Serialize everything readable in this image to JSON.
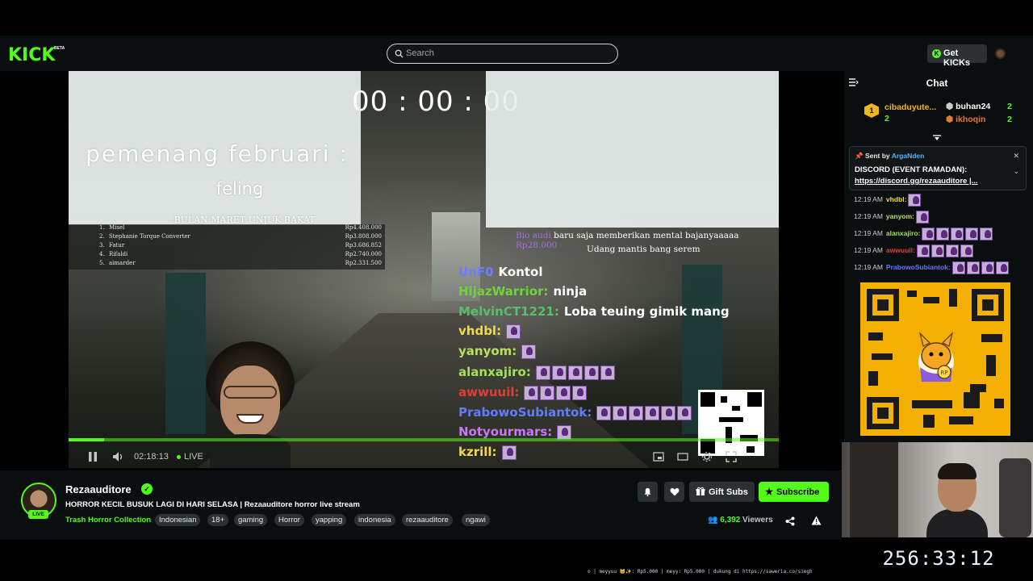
{
  "header": {
    "logo": "KICK",
    "logo_badge": "BETA",
    "search_placeholder": "Search",
    "get_kicks_label": "Get KICKs"
  },
  "overlay": {
    "countdown": "00 : 00 : 00",
    "winner_title": "pemenang februari :",
    "winner_name": "feling",
    "winner_sub": "BULAN MARET UNJUK BAKAT",
    "leaderboard": [
      {
        "rank": "1.",
        "name": "Misel",
        "amount": "Rp4.408.000"
      },
      {
        "rank": "2.",
        "name": "Stephanie Torque Converter",
        "amount": "Rp3.808.000"
      },
      {
        "rank": "3.",
        "name": "Fatur",
        "amount": "Rp3.686.852"
      },
      {
        "rank": "4.",
        "name": "Rifaldi",
        "amount": "Rp2.740.000"
      },
      {
        "rank": "5.",
        "name": "aimarder",
        "amount": "Rp2.331.500"
      }
    ],
    "donation": {
      "name": "Bio audi",
      "text": " baru saja memberikan mental bajanyaaaaa ",
      "amount": "Rp28.000",
      "message": "Udang mantis bang serem"
    },
    "chat_lines": [
      {
        "user": "UnF0",
        "text": "Kontol",
        "color": "#6d7bff"
      },
      {
        "user": "HijazWarrior:",
        "text": "ninja",
        "color": "#6fd33a"
      },
      {
        "user": "MelvinCT1221:",
        "text": "Loba teuing gimik mang",
        "color": "#55c06a"
      },
      {
        "user": "vhdbl:",
        "text": "",
        "color": "#f2d84b",
        "emotes": 1
      },
      {
        "user": "yanyom:",
        "text": "",
        "color": "#b6e35a",
        "emotes": 1
      },
      {
        "user": "alanxajiro:",
        "text": "",
        "color": "#9fe35a",
        "emotes": 5
      },
      {
        "user": "awwuuil:",
        "text": "",
        "color": "#e23b3b",
        "emotes": 4
      },
      {
        "user": "PrabowoSubiantok:",
        "text": "",
        "color": "#5f7cff",
        "emotes": 10
      },
      {
        "user": "Notyourmars:",
        "text": "",
        "color": "#c778f2",
        "emotes": 1
      },
      {
        "user": "kzrill:",
        "text": "",
        "color": "#f2d84b",
        "emotes": 1
      }
    ]
  },
  "player": {
    "elapsed": "02:18:13",
    "live_label": "LIVE",
    "progress": 0.05
  },
  "chat": {
    "title": "Chat",
    "leaders": [
      {
        "name": "cibaduyute...",
        "count": "2"
      },
      {
        "name": "buhan24",
        "count": "2"
      },
      {
        "name": "ikhoqin",
        "count": "2"
      }
    ],
    "pinned": {
      "sent_by_label": "Sent by",
      "sender": "ArgaNden",
      "title": "DISCORD (EVENT RAMADAN):",
      "link": "https://discord.gg/rezaauditore |..."
    },
    "messages": [
      {
        "time": "12:19 AM",
        "user": "vhdbl:",
        "color": "#f2d84b",
        "emotes": 1
      },
      {
        "time": "12:19 AM",
        "user": "yanyom:",
        "color": "#b6e35a",
        "emotes": 1
      },
      {
        "time": "12:19 AM",
        "user": "alanxajiro:",
        "color": "#9fe35a",
        "emotes": 5
      },
      {
        "time": "12:19 AM",
        "user": "awwuuil:",
        "color": "#e23b3b",
        "emotes": 4
      },
      {
        "time": "12:19 AM",
        "user": "PrabowoSubiantok:",
        "color": "#5f7cff",
        "emotes": 4
      }
    ]
  },
  "stream": {
    "channel": "Rezaauditore",
    "live_badge": "LIVE",
    "title": "HORROR KECIL BUSUK LAGI DI HARI SELASA | Rezaauditore horror live stream",
    "category": "Trash Horror Collection",
    "tags": [
      "Indonesian",
      "18+",
      "gaming",
      "Horror",
      "yapping",
      "indonesia",
      "rezaauditore",
      "ngawi"
    ],
    "gift_label": "Gift Subs",
    "subscribe_label": "Subscribe",
    "viewers_count": "6,392",
    "viewers_label": "Viewers"
  },
  "stream_clock": "256:33:12",
  "ticker": "⊙ | meyyuu 🐱✨: Rp5.000 | meyy: Rp5.000 |  dukung di https://saweria.co/siegh",
  "colors": {
    "accent": "#53fc18",
    "background": "#0b0e0f",
    "button": "#2b3133"
  }
}
